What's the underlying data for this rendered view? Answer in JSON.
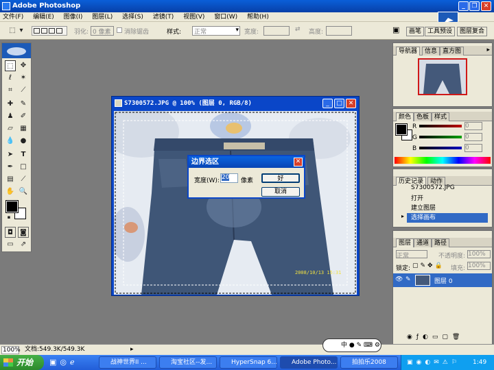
{
  "app": {
    "title": "Adobe Photoshop"
  },
  "menu": [
    "文件(F)",
    "编辑(E)",
    "图像(I)",
    "图层(L)",
    "选择(S)",
    "滤镜(T)",
    "视图(V)",
    "窗口(W)",
    "帮助(H)"
  ],
  "options": {
    "feather_label": "羽化:",
    "feather_value": "0 像素",
    "antialias_label": "消除锯齿",
    "style_label": "样式:",
    "style_value": "正常",
    "width_label": "宽度:",
    "height_label": "高度:",
    "wells": [
      "画笔",
      "工具预设",
      "图层复合"
    ]
  },
  "document": {
    "title": "S7300572.JPG @ 100% (图层 0, RGB/8)",
    "timestamp": "2008/10/13 15:31"
  },
  "dialog": {
    "title": "边界选区",
    "width_label": "宽度(W):",
    "width_value": "20",
    "unit": "像素",
    "ok": "好",
    "cancel": "取消"
  },
  "navigator": {
    "tabs": [
      "导航器",
      "信息",
      "直方图"
    ]
  },
  "color": {
    "tabs": [
      "颜色",
      "色板",
      "样式"
    ],
    "channels": [
      {
        "label": "R",
        "value": "0"
      },
      {
        "label": "G",
        "value": "0"
      },
      {
        "label": "B",
        "value": "0"
      }
    ],
    "channel_colors": [
      "#c00000",
      "#00a000",
      "#0000c0"
    ]
  },
  "history": {
    "tabs": [
      "历史记录",
      "动作"
    ],
    "snapshot": "S7300572.JPG",
    "items": [
      "打开",
      "建立图层",
      "选择画布"
    ]
  },
  "layers": {
    "tabs": [
      "图层",
      "通道",
      "路径"
    ],
    "blend": "正常",
    "opacity_label": "不透明度:",
    "opacity": "100%",
    "lock_label": "锁定:",
    "fill_label": "填充:",
    "fill": "100%",
    "layer_name": "图层 0"
  },
  "status": {
    "zoom": "100%",
    "doc": "文档:549.3K/549.3K"
  },
  "taskbar": {
    "start": "开始",
    "tasks": [
      "战神世界II ...",
      "淘宝社区--发...",
      "HyperSnap 6...",
      "Adobe Photo...",
      "拍拍乐2008"
    ],
    "time": "1:49",
    "ime": "中"
  }
}
